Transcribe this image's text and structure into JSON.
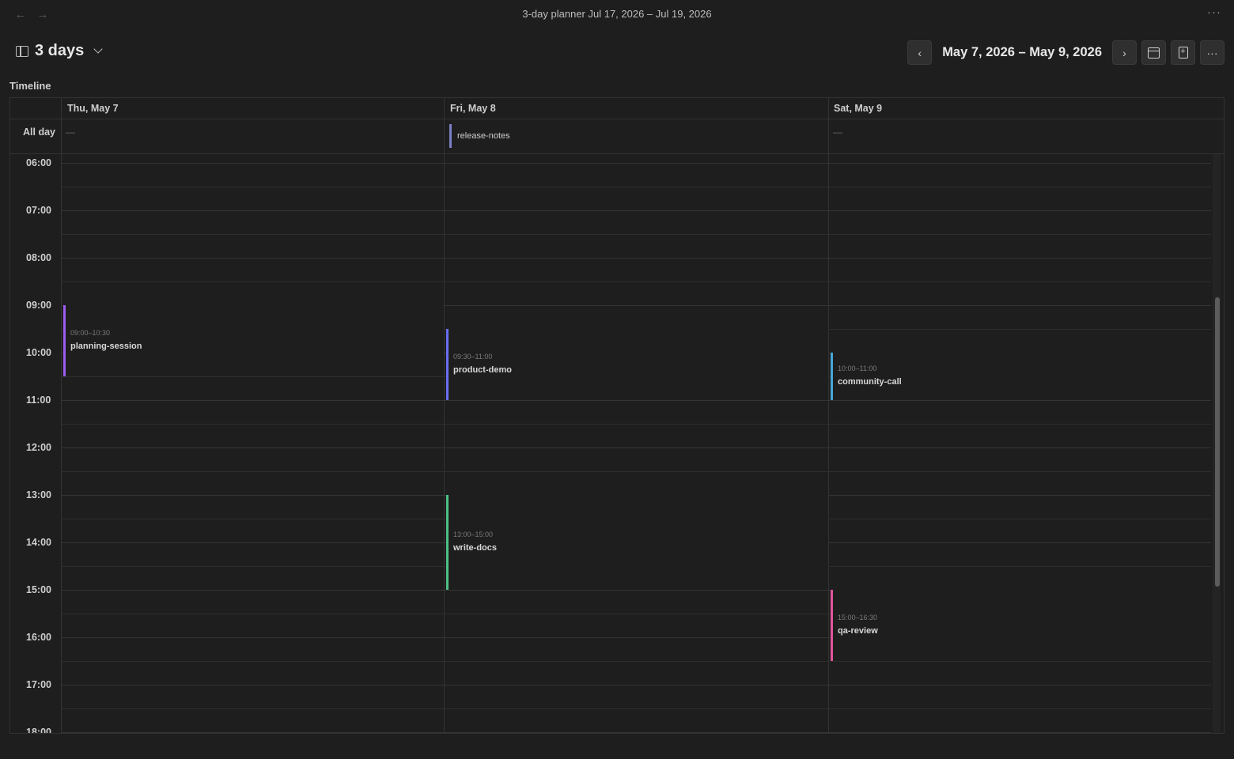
{
  "titlebar": {
    "title": "3-day planner Jul 17, 2026 – Jul 19, 2026",
    "back_icon": "arrow-left-icon",
    "forward_icon": "arrow-right-icon",
    "more_icon": "ellipsis-icon"
  },
  "header": {
    "view_title": "3 days",
    "range": "May 7, 2026 – May 9, 2026"
  },
  "section_label": "Timeline",
  "days": [
    {
      "label": "Thu, May 7",
      "allday": "—"
    },
    {
      "label": "Fri, May 8",
      "allday": "release-notes"
    },
    {
      "label": "Sat, May 9",
      "allday": "—"
    }
  ],
  "allday_label": "All day",
  "hours": [
    "06:00",
    "07:00",
    "08:00",
    "09:00",
    "10:00",
    "11:00",
    "12:00",
    "13:00",
    "14:00",
    "15:00",
    "16:00",
    "17:00",
    "18:00"
  ],
  "events": [
    {
      "day": 0,
      "start": 9.0,
      "end": 10.5,
      "time": "09:00–10:30",
      "name": "planning-session",
      "color": "#9b5cf0"
    },
    {
      "day": 1,
      "start": 9.5,
      "end": 11.0,
      "time": "09:30–11:00",
      "name": "product-demo",
      "color": "#6a6ff0"
    },
    {
      "day": 2,
      "start": 10.0,
      "end": 11.0,
      "time": "10:00–11:00",
      "name": "community-call",
      "color": "#49a6d6"
    },
    {
      "day": 1,
      "start": 13.0,
      "end": 15.0,
      "time": "13:00–15:00",
      "name": "write-docs",
      "color": "#4fbf86"
    },
    {
      "day": 2,
      "start": 15.0,
      "end": 16.5,
      "time": "15:00–16:30",
      "name": "qa-review",
      "color": "#e0569a"
    }
  ],
  "colors": {
    "background": "#1e1e1e",
    "allday_accent": "#7b7fc4"
  }
}
